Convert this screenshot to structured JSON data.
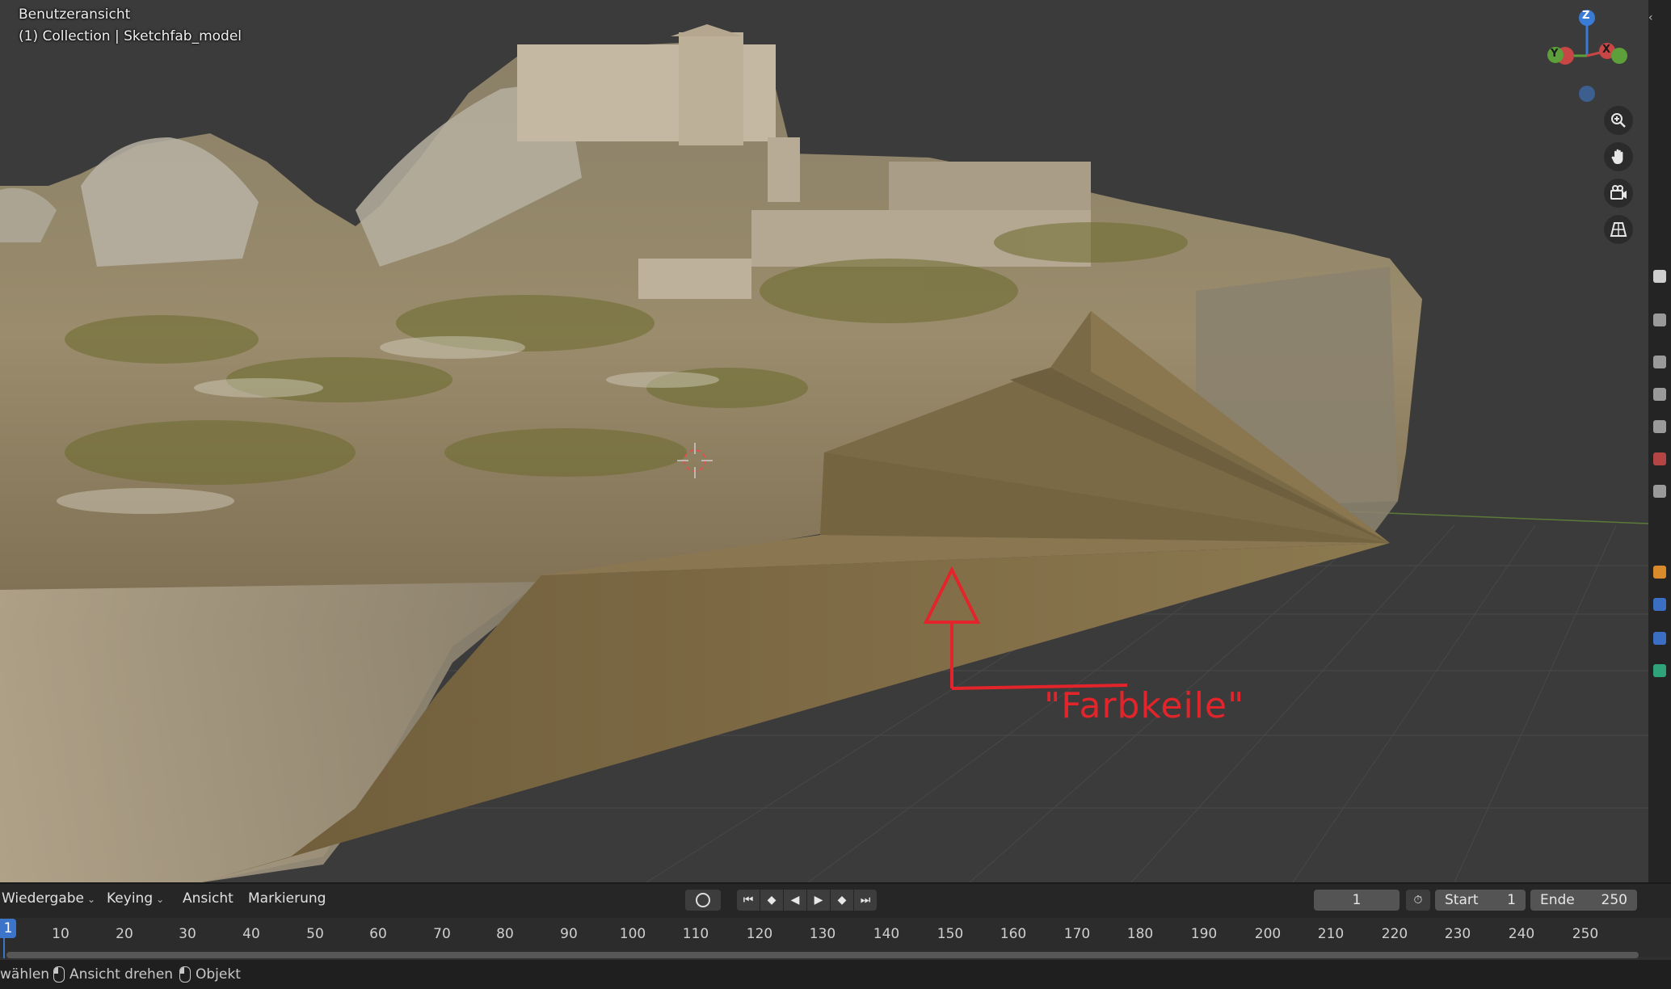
{
  "viewport": {
    "view_name": "Benutzeransicht",
    "collection_path": "(1) Collection | Sketchfab_model",
    "gizmo": {
      "z": "Z",
      "y": "Y",
      "x": "X"
    },
    "nav_icons": [
      "zoom-icon",
      "hand-pan-icon",
      "camera-icon",
      "grid-perspective-icon"
    ],
    "annotation": "\"Farbkeile\"",
    "colors": {
      "background": "#3b3b3b",
      "grid": "#4a4a4a",
      "wedge": "#7d6a45",
      "annotation": "#e3242b"
    }
  },
  "timeline": {
    "menus": [
      "Wiedergabe",
      "Keying",
      "Ansicht",
      "Markierung"
    ],
    "current_frame": "1",
    "start_label": "Start",
    "start_value": "1",
    "end_label": "Ende",
    "end_value": "250",
    "ruler_ticks": [
      "10",
      "20",
      "30",
      "40",
      "50",
      "60",
      "70",
      "80",
      "90",
      "100",
      "110",
      "120",
      "130",
      "140",
      "150",
      "160",
      "170",
      "180",
      "190",
      "200",
      "210",
      "220",
      "230",
      "240",
      "250"
    ],
    "playhead_frame": "1"
  },
  "statusbar": {
    "items": [
      "wählen",
      "Ansicht drehen",
      "Objekt"
    ]
  }
}
